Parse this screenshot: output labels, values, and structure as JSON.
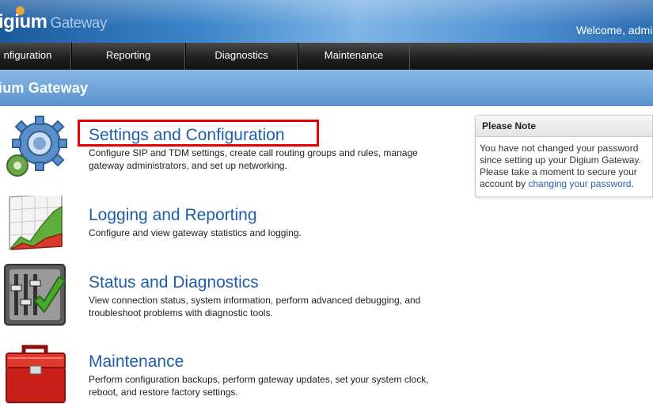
{
  "header": {
    "logo_text": "igium",
    "logo_sub": "Gateway",
    "welcome": "Welcome, admi"
  },
  "nav": {
    "items": [
      {
        "label": "nfiguration"
      },
      {
        "label": "Reporting"
      },
      {
        "label": "Diagnostics"
      },
      {
        "label": "Maintenance"
      }
    ]
  },
  "banner": {
    "title": "ium Gateway"
  },
  "sections": [
    {
      "title": "Settings and Configuration",
      "description": "Configure SIP and TDM settings, create call routing groups and rules, manage gateway administrators, and set up networking.",
      "icon": "gears-icon"
    },
    {
      "title": "Logging and Reporting",
      "description": "Configure and view gateway statistics and logging.",
      "icon": "chart-icon"
    },
    {
      "title": "Status and Diagnostics",
      "description": "View connection status, system information, perform advanced debugging, and troubleshoot problems with diagnostic tools.",
      "icon": "diagnostics-icon"
    },
    {
      "title": "Maintenance",
      "description": "Perform configuration backups, perform gateway updates, set your system clock, reboot, and restore factory settings.",
      "icon": "toolbox-icon"
    }
  ],
  "note": {
    "title": "Please Note",
    "body_text": "You have not changed your password since setting up your Digium Gateway. Please take a moment to secure your account by ",
    "link_text": "changing your password",
    "body_end": "."
  },
  "colors": {
    "accent": "#1e5ea8",
    "highlight": "#ee0000"
  }
}
